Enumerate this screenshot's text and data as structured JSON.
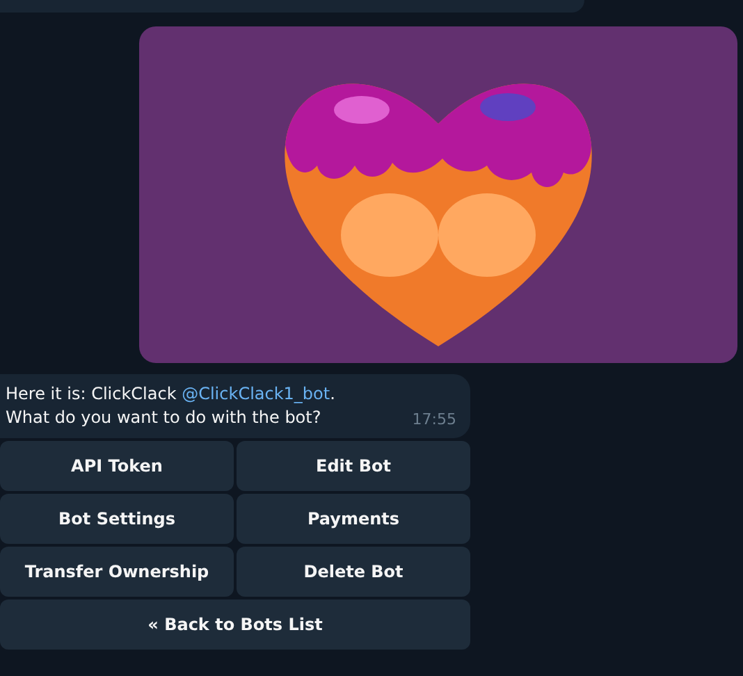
{
  "image_message": {
    "kind": "picture"
  },
  "message": {
    "line1_prefix": "Here it is: ClickClack ",
    "mention": "@ClickClack1_bot",
    "line1_suffix": ".",
    "line2": "What do you want to do with the bot?",
    "time": "17:55"
  },
  "keyboard": [
    [
      "API Token",
      "Edit Bot"
    ],
    [
      "Bot Settings",
      "Payments"
    ],
    [
      "Transfer Ownership",
      "Delete Bot"
    ],
    [
      "« Back to Bots List"
    ]
  ]
}
